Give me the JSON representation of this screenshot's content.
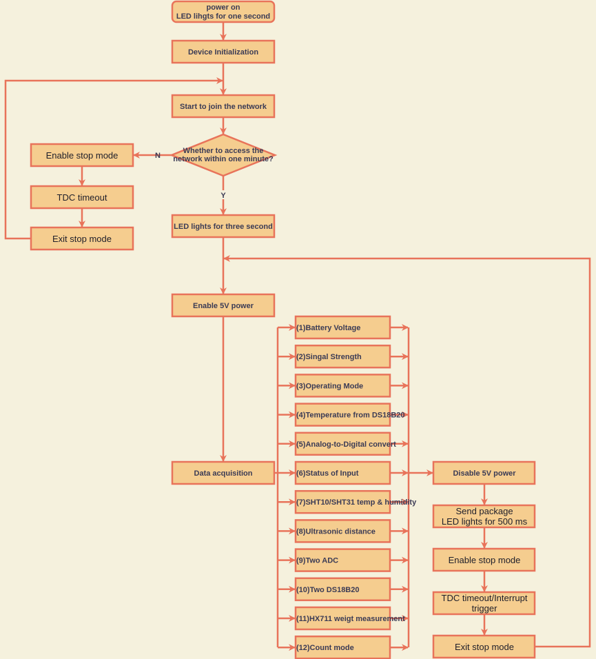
{
  "colors": {
    "background": "#f5f1dd",
    "box_fill": "#f5cd8f",
    "stroke": "#e8735a",
    "text": "#3b3b55"
  },
  "main": {
    "power_on_1": "power on",
    "power_on_2": "LED lihgts for one second",
    "device_init": "Device Initialization",
    "join_network": "Start to join the network",
    "decision_1": "Whether to access the",
    "decision_2": "network within one minute?",
    "no_label": "N",
    "yes_label": "Y",
    "led_three": "LED lights for three second",
    "enable_5v": "Enable 5V power",
    "data_acq": "Data acquisition"
  },
  "retry": {
    "enable_stop": "Enable stop mode",
    "tdc_timeout": "TDC timeout",
    "exit_stop": "Exit stop mode"
  },
  "items": [
    "(1)Battery Voltage",
    "(2)Singal Strength",
    "(3)Operating Mode",
    "(4)Temperature from DS18B20",
    "(5)Analog-to-Digital convert",
    "(6)Status of Input",
    "(7)SHT10/SHT31 temp & humidity",
    "(8)Ultrasonic distance",
    "(9)Two ADC",
    "(10)Two DS18B20",
    "(11)HX711 weigt measurement",
    "(12)Count mode"
  ],
  "send": {
    "disable_5v": "Disable 5V power",
    "send_1": "Send package",
    "send_2": "LED lights for 500 ms",
    "enable_stop": "Enable stop mode",
    "tdc_1": "TDC timeout/Interrupt",
    "tdc_2": "trigger",
    "exit_stop": "Exit stop mode"
  }
}
